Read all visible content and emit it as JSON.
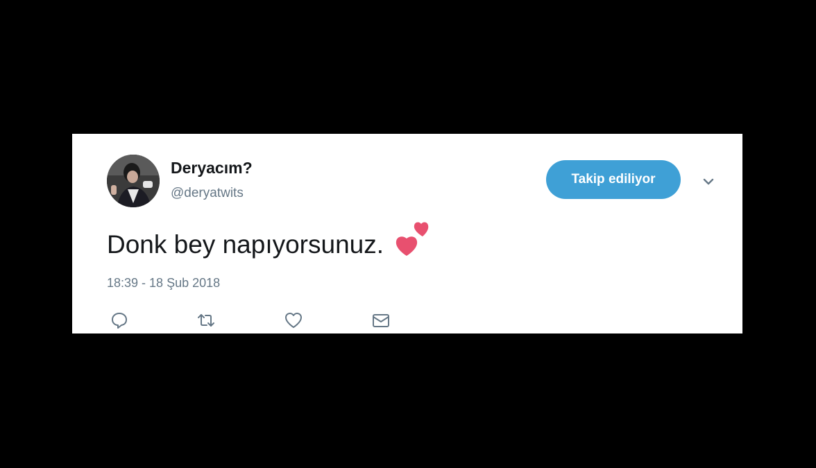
{
  "tweet": {
    "display_name": "Deryacım?",
    "handle": "@deryatwits",
    "follow_button_label": "Takip ediliyor",
    "text": "Donk bey napıyorsunuz.",
    "emoji": "two-hearts",
    "timestamp": "18:39 - 18 Şub 2018"
  },
  "actions": [
    {
      "icon": "reply-icon"
    },
    {
      "icon": "retweet-icon"
    },
    {
      "icon": "like-icon"
    },
    {
      "icon": "direct-message-icon"
    }
  ],
  "colors": {
    "background": "#000000",
    "card": "#ffffff",
    "button": "#3fa0d6",
    "name": "#14171a",
    "secondary": "#657786",
    "heart": "#e0245e"
  }
}
